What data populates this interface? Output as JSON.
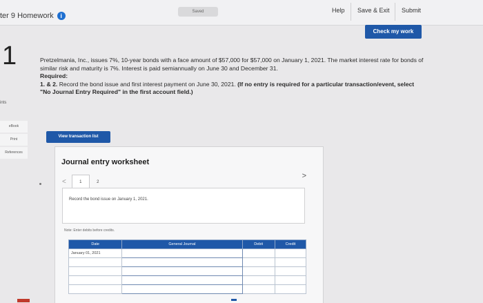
{
  "header": {
    "chapter_title": "ter 9 Homework",
    "saved_label": "Saved",
    "help_label": "Help",
    "save_exit_label": "Save & Exit",
    "submit_label": "Submit"
  },
  "check_work_label": "Check my work",
  "question_number": "1",
  "points_label": "ints",
  "sidebar": {
    "ebook": "eBook",
    "print": "Print",
    "references": "References"
  },
  "question": {
    "text": "Pretzelmania, Inc., issues 7%, 10-year bonds with a face amount of $57,000 for $57,000 on January 1, 2021. The market interest rate for bonds of similar risk and maturity is 7%. Interest is paid semiannually on June 30 and December 31.",
    "required_label": "Required:",
    "req_prefix": "1. & 2.",
    "req_text": " Record the bond issue and first interest payment on June 30, 2021. ",
    "req_bold": "(If no entry is required for a particular transaction/event, select \"No Journal Entry Required\" in the first account field.)"
  },
  "view_transaction_list_label": "View transaction list",
  "worksheet": {
    "title": "Journal entry worksheet",
    "pages": [
      "1",
      "2"
    ],
    "instruction": "Record the bond issue on January 1, 2021.",
    "note": "Note: Enter debits before credits.",
    "columns": [
      "Date",
      "General Journal",
      "Debit",
      "Credit"
    ],
    "rows": [
      [
        "January 01, 2021",
        "",
        "",
        ""
      ],
      [
        "",
        "",
        "",
        ""
      ],
      [
        "",
        "",
        "",
        ""
      ],
      [
        "",
        "",
        "",
        ""
      ],
      [
        "",
        "",
        "",
        ""
      ]
    ]
  },
  "colors": {
    "primary_blue": "#1f58a8",
    "info_icon_blue": "#1e6fd0"
  }
}
